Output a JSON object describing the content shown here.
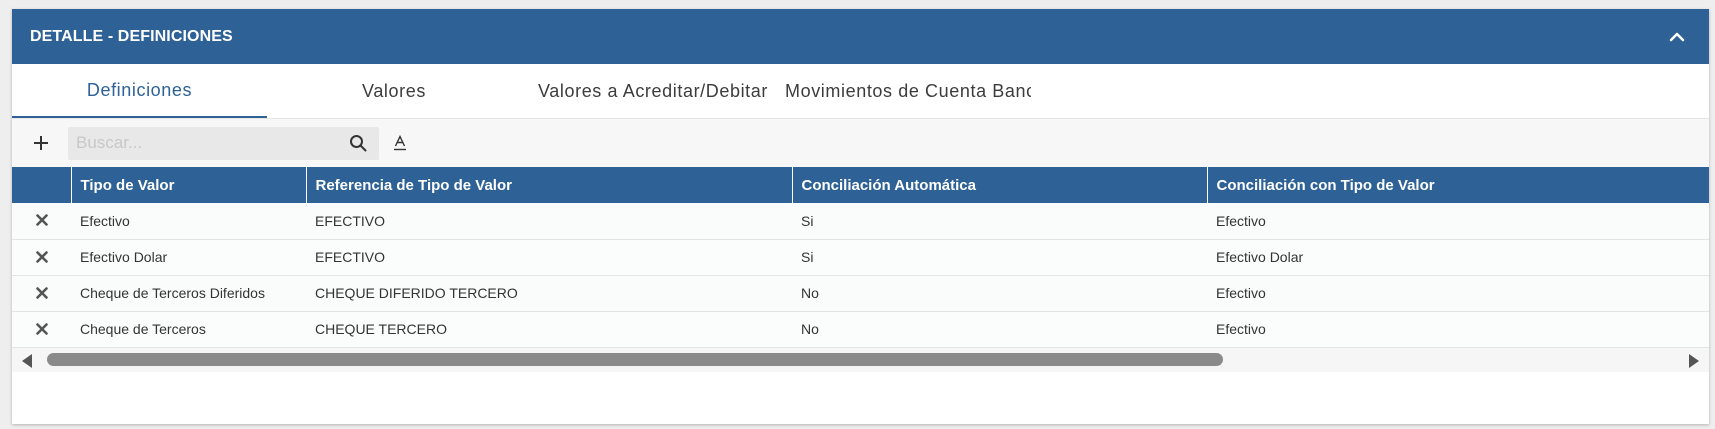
{
  "panel": {
    "title": "DETALLE - DEFINICIONES"
  },
  "tabs": [
    {
      "label": "Definiciones",
      "active": true
    },
    {
      "label": "Valores",
      "active": false
    },
    {
      "label": "Valores a Acreditar/Debitar",
      "active": false
    },
    {
      "label": "Movimientos de Cuenta Bancaria",
      "active": false
    }
  ],
  "toolbar": {
    "add_label": "+",
    "search_placeholder": "Buscar...",
    "search_value": ""
  },
  "table": {
    "columns": [
      "",
      "Tipo de Valor",
      "Referencia de Tipo de Valor",
      "Conciliación Automática",
      "Conciliación con Tipo de Valor"
    ],
    "rows": [
      [
        "Efectivo",
        "EFECTIVO",
        "Si",
        "Efectivo"
      ],
      [
        "Efectivo Dolar",
        "EFECTIVO",
        "Si",
        "Efectivo Dolar"
      ],
      [
        "Cheque de Terceros Diferidos",
        "CHEQUE DIFERIDO TERCERO",
        "No",
        "Efectivo"
      ],
      [
        "Cheque de Terceros",
        "CHEQUE TERCERO",
        "No",
        "Efectivo"
      ]
    ]
  },
  "colors": {
    "header": "#2e6297",
    "accent": "#2e6297"
  },
  "icons": {
    "collapse": "chevron-up-icon",
    "add": "plus-icon",
    "search": "search-icon",
    "format": "text-format-icon",
    "delete": "close-icon"
  }
}
